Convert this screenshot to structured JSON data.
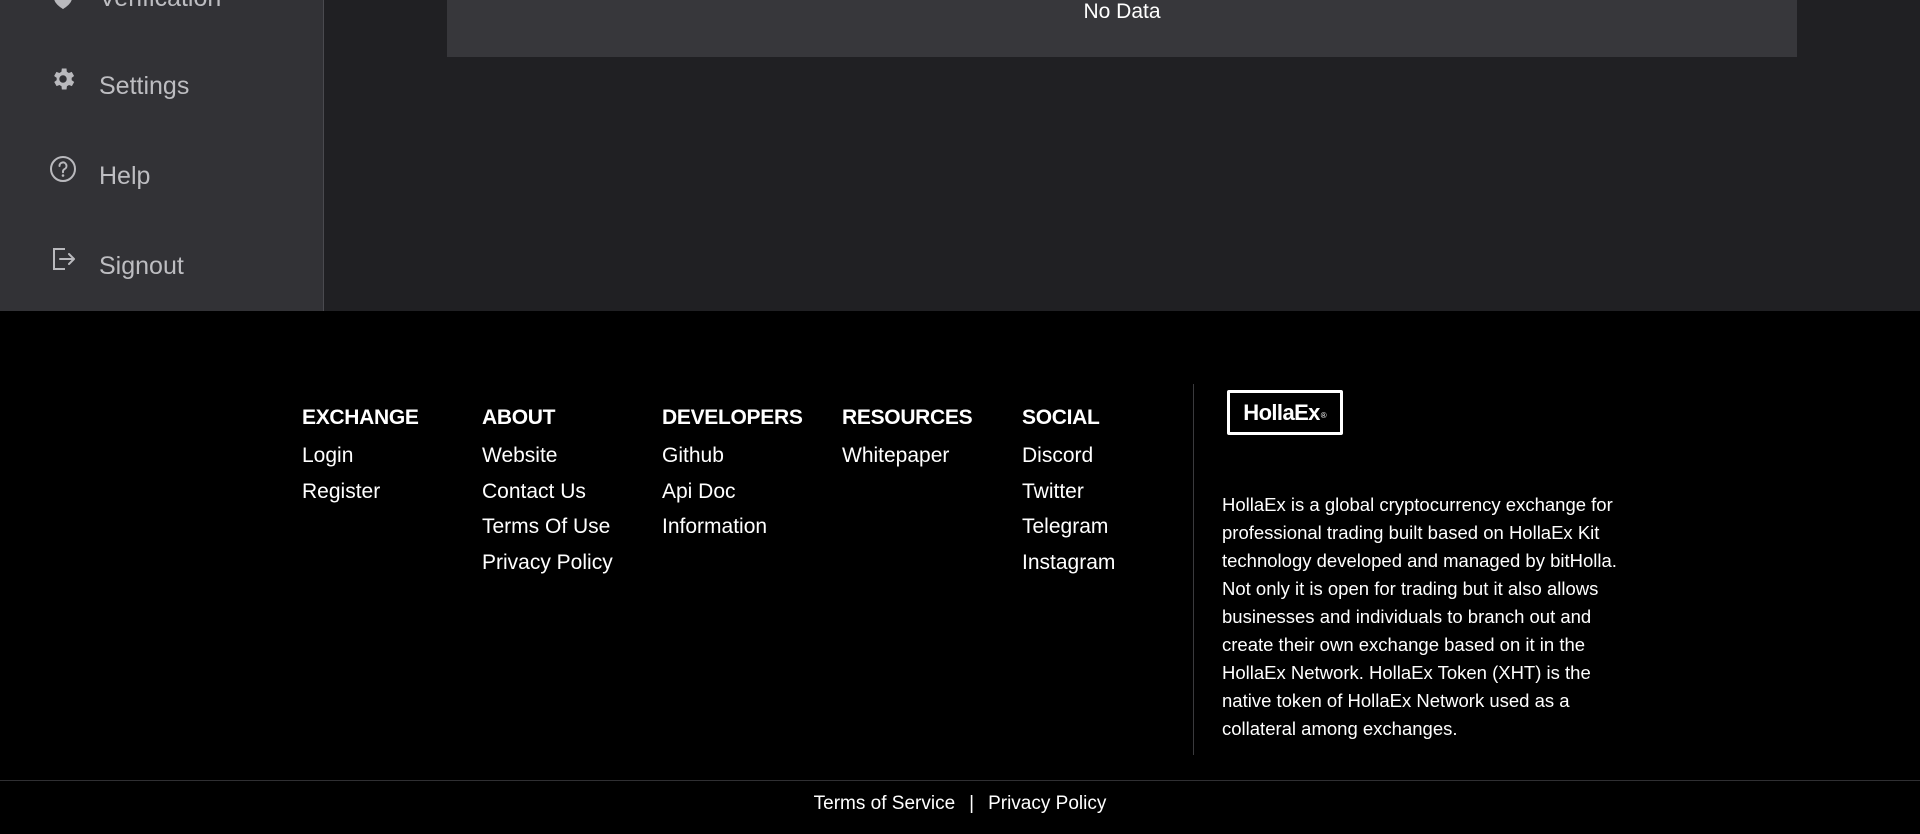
{
  "sidebar": {
    "items": [
      {
        "label": "Verification",
        "icon": "verification-icon"
      },
      {
        "label": "Settings",
        "icon": "gear-icon"
      },
      {
        "label": "Help",
        "icon": "help-icon"
      },
      {
        "label": "Signout",
        "icon": "signout-icon"
      }
    ]
  },
  "main": {
    "empty_message": "No Data"
  },
  "footer": {
    "columns": [
      {
        "heading": "EXCHANGE",
        "links": [
          "Login",
          "Register"
        ]
      },
      {
        "heading": "ABOUT",
        "links": [
          "Website",
          "Contact Us",
          "Terms Of Use",
          "Privacy Policy"
        ]
      },
      {
        "heading": "DEVELOPERS",
        "links": [
          "Github",
          "Api Doc",
          "Information"
        ]
      },
      {
        "heading": "RESOURCES",
        "links": [
          "Whitepaper"
        ]
      },
      {
        "heading": "SOCIAL",
        "links": [
          "Discord",
          "Twitter",
          "Telegram",
          "Instagram"
        ]
      }
    ],
    "logo_text": "HollaEx",
    "logo_mark": "®",
    "description": "HollaEx is a global cryptocurrency exchange for professional trading built based on HollaEx Kit technology developed and managed by bitHolla. Not only it is open for trading but it also allows businesses and individuals to branch out and create their own exchange based on it in the HollaEx Network. HollaEx Token (XHT) is the native token of HollaEx Network used as a collateral among exchanges.",
    "bottom_links": {
      "terms": "Terms of Service",
      "separator": "|",
      "privacy": "Privacy Policy"
    }
  },
  "colors": {
    "sidebar_bg": "#323236",
    "main_bg": "#202023",
    "panel_bg": "#37373b",
    "footer_bg": "#000000"
  }
}
